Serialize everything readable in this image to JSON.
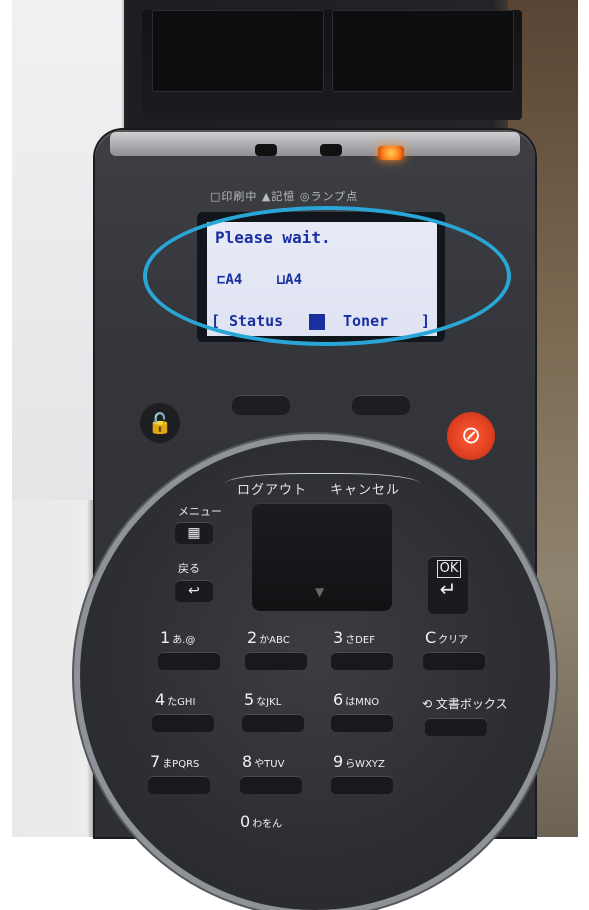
{
  "lcd": {
    "line1": "Please wait.",
    "paper_left": "A4",
    "paper_right": "A4",
    "softkey_left": "Status",
    "softkey_right": "Toner",
    "bracket_left": "[",
    "bracket_right": "]"
  },
  "panel_top_labels": "□印刷中 ▲記憶 ◎ランプ点",
  "controls": {
    "logout": "ログアウト",
    "cancel": "キャンセル",
    "menu_label": "メニュー",
    "back_label": "戻る",
    "ok": "OK"
  },
  "keypad": [
    {
      "digit": "1",
      "sub": "あ.@"
    },
    {
      "digit": "2",
      "sub": "かABC"
    },
    {
      "digit": "3",
      "sub": "さDEF"
    },
    {
      "digit": "C",
      "sub": "クリア"
    },
    {
      "digit": "4",
      "sub": "たGHI"
    },
    {
      "digit": "5",
      "sub": "なJKL"
    },
    {
      "digit": "6",
      "sub": "はMNO"
    },
    {
      "digit": "7",
      "sub": "まPQRS"
    },
    {
      "digit": "8",
      "sub": "やTUV"
    },
    {
      "digit": "9",
      "sub": "らWXYZ"
    },
    {
      "digit": "0",
      "sub": "わをん"
    }
  ],
  "mailbox_label": "文書ボックス",
  "colors": {
    "highlight_ring": "#2aa6d6",
    "lcd_text": "#1a2fa0",
    "stop_button": "#e0401f",
    "status_led": "#ff7a1a"
  }
}
